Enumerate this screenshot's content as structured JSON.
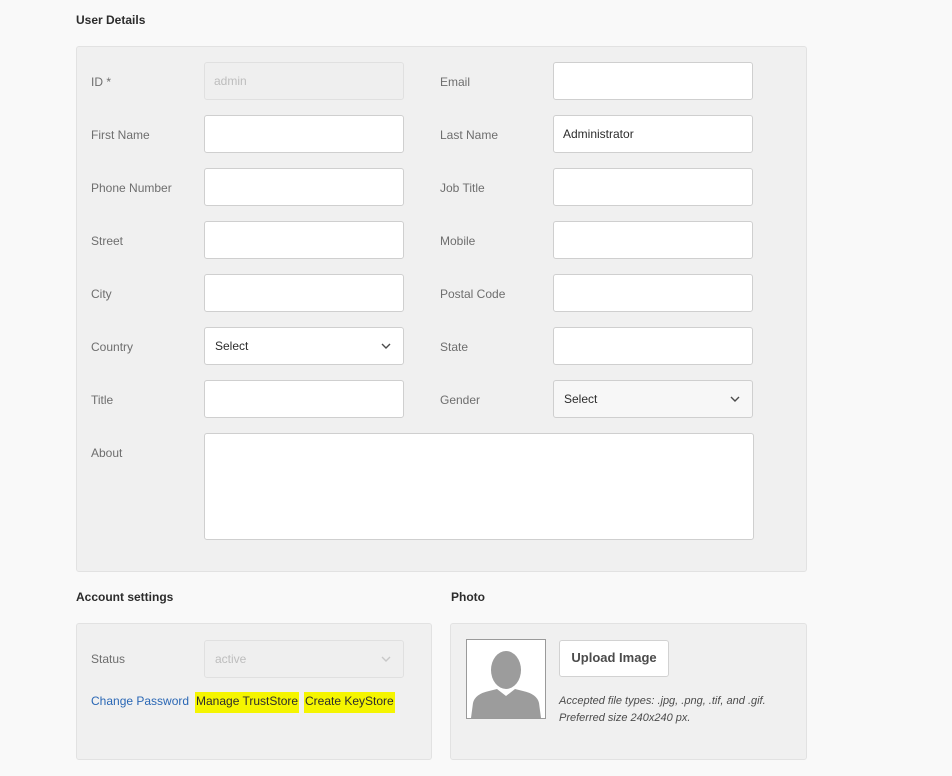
{
  "user_details": {
    "heading": "User Details",
    "fields": {
      "id": {
        "label": "ID *",
        "value": "admin"
      },
      "email": {
        "label": "Email",
        "value": ""
      },
      "first_name": {
        "label": "First Name",
        "value": ""
      },
      "last_name": {
        "label": "Last Name",
        "value": "Administrator"
      },
      "phone": {
        "label": "Phone Number",
        "value": ""
      },
      "job_title": {
        "label": "Job Title",
        "value": ""
      },
      "street": {
        "label": "Street",
        "value": ""
      },
      "mobile": {
        "label": "Mobile",
        "value": ""
      },
      "city": {
        "label": "City",
        "value": ""
      },
      "postal_code": {
        "label": "Postal Code",
        "value": ""
      },
      "country": {
        "label": "Country",
        "value": "Select"
      },
      "state": {
        "label": "State",
        "value": ""
      },
      "title": {
        "label": "Title",
        "value": ""
      },
      "gender": {
        "label": "Gender",
        "value": "Select"
      },
      "about": {
        "label": "About",
        "value": ""
      }
    }
  },
  "account_settings": {
    "heading": "Account settings",
    "status_label": "Status",
    "status_value": "active",
    "links": {
      "change_password": "Change Password",
      "manage_truststore": "Manage TrustStore",
      "create_keystore": "Create KeyStore"
    }
  },
  "photo": {
    "heading": "Photo",
    "upload_label": "Upload Image",
    "hint_line1": "Accepted file types: .jpg, .png, .tif, and .gif.",
    "hint_line2": "Preferred size 240x240 px."
  },
  "colors": {
    "link": "#2a67b5",
    "highlight": "#f5f500",
    "panel": "#f0f0f0"
  }
}
